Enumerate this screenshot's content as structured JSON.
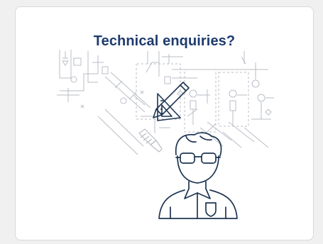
{
  "card": {
    "title": "Technical enquiries?"
  },
  "illustration": {
    "icon": "technician-with-schematic-icon",
    "colors": {
      "line_dark": "#1e3552",
      "line_light": "#b9bec6",
      "title": "#1e3b6f"
    }
  }
}
